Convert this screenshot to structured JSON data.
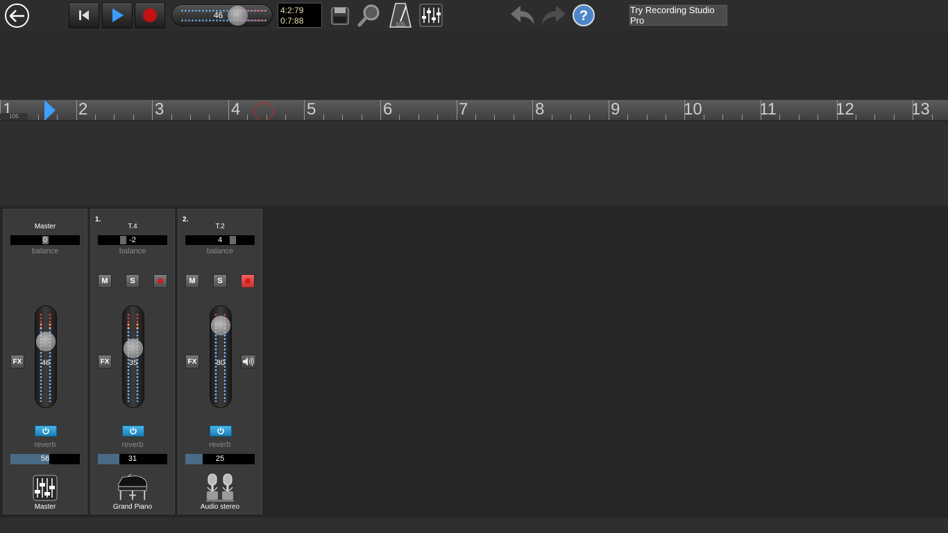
{
  "toolbar": {
    "master_volume": "46",
    "position_bars": "4:2:79",
    "position_time": "0:7:88",
    "metronome_tempo": "105",
    "try_pro_label": "Try Recording Studio Pro",
    "icons": [
      "back-arrow-icon",
      "skip-to-start-icon",
      "play-icon",
      "record-icon",
      "save-icon",
      "zoom-icon",
      "metronome-icon",
      "mixer-icon",
      "undo-icon",
      "redo-icon",
      "help-icon"
    ]
  },
  "ruler": {
    "tempo": "105",
    "marks": [
      "1",
      "2",
      "3",
      "4",
      "5",
      "6",
      "7",
      "8",
      "9",
      "10",
      "11",
      "12",
      "13"
    ]
  },
  "mixer": {
    "channels": [
      {
        "number": "",
        "name": "Master",
        "balance": "0",
        "balance_label": "balance",
        "volume": "46",
        "fx_label": "FX",
        "reverb_label": "reverb",
        "reverb": "56",
        "instrument": "Master",
        "mute": "",
        "solo": "",
        "balance_fraction": 0.5,
        "volume_fraction": 0.46,
        "reverb_fraction": 0.56
      },
      {
        "number": "1.",
        "name": "T.4",
        "balance": "-2",
        "balance_label": "balance",
        "volume": "35",
        "fx_label": "FX",
        "reverb_label": "reverb",
        "reverb": "31",
        "instrument": "Grand Piano",
        "mute": "M",
        "solo": "S",
        "balance_fraction": 0.48,
        "volume_fraction": 0.35,
        "reverb_fraction": 0.31
      },
      {
        "number": "2.",
        "name": "T.2",
        "balance": "4",
        "balance_label": "balance",
        "volume": "80",
        "fx_label": "FX",
        "reverb_label": "reverb",
        "reverb": "25",
        "instrument": "Audio stereo",
        "mute": "M",
        "solo": "S",
        "balance_fraction": 0.54,
        "volume_fraction": 0.8,
        "reverb_fraction": 0.25
      }
    ]
  }
}
